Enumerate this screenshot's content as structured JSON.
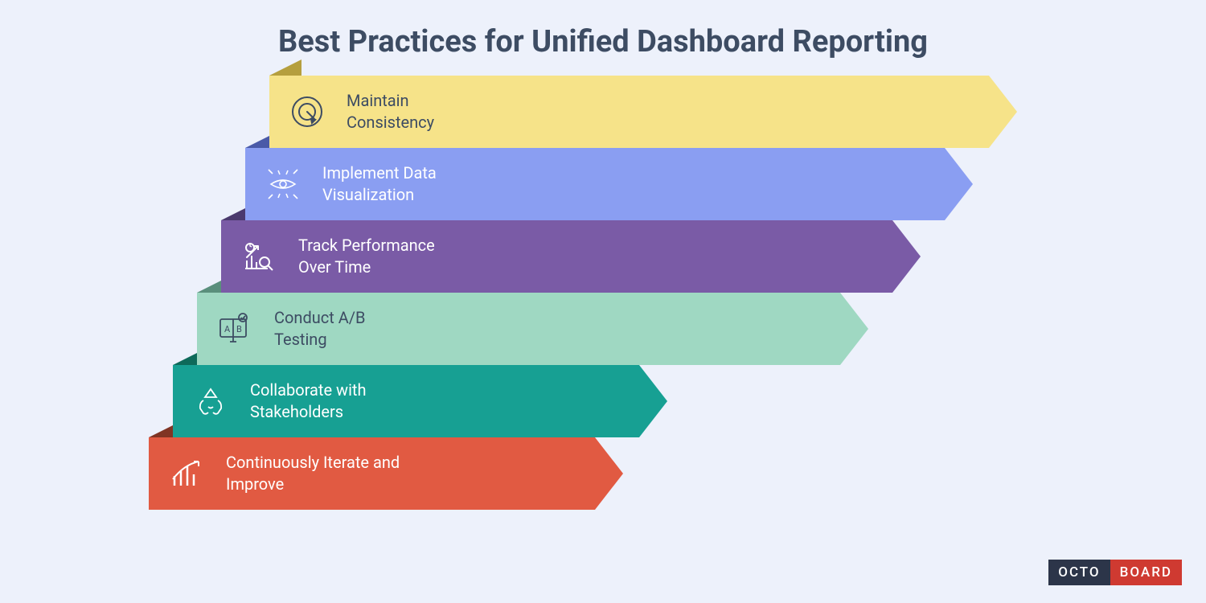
{
  "title": "Best Practices for Unified Dashboard Reporting",
  "rows": [
    {
      "line1": "Maintain",
      "line2": "Consistency",
      "dark": true
    },
    {
      "line1": "Implement Data",
      "line2": "Visualization",
      "dark": false
    },
    {
      "line1": "Track Performance",
      "line2": "Over Time",
      "dark": false
    },
    {
      "line1": "Conduct A/B",
      "line2": "Testing",
      "dark": true
    },
    {
      "line1": "Collaborate with",
      "line2": "Stakeholders",
      "dark": false
    },
    {
      "line1": "Continuously Iterate and",
      "line2": "Improve",
      "dark": false
    }
  ],
  "logo": {
    "part1": "OCTO",
    "part2": "BOARD"
  }
}
